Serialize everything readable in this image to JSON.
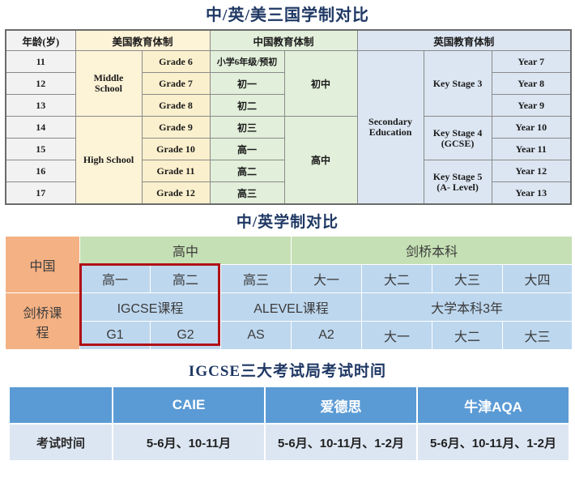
{
  "colors": {
    "title": "#1f3864",
    "us_bg": "#fdf3d7",
    "cn_bg": "#e2efda",
    "uk_bg": "#dce6f2",
    "age_bg": "#f2f2f2",
    "orange": "#f4b183",
    "green": "#c5e0b4",
    "blue_light": "#bdd7ee",
    "blue_header": "#5b9bd5",
    "highlight_border": "#b01116"
  },
  "section1": {
    "title": "中/英/美三国学制对比",
    "headers": {
      "age": "年龄(岁)",
      "us": "美国教育体制",
      "cn": "中国教育体制",
      "uk": "英国教育体制"
    },
    "rows": [
      {
        "age": "11",
        "us_school": "Middle\nSchool",
        "us_grade": "Grade 6",
        "cn_grade": "小学6年级/预初",
        "cn_stage": "初中",
        "uk_stage": "Secondary\nEducation",
        "uk_key": "Key Stage 3",
        "uk_year": "Year 7"
      },
      {
        "age": "12",
        "us_grade": "Grade 7",
        "cn_grade": "初一",
        "uk_year": "Year 8"
      },
      {
        "age": "13",
        "us_grade": "Grade 8",
        "cn_grade": "初二",
        "uk_year": "Year 9"
      },
      {
        "age": "14",
        "us_school": "High School",
        "us_grade": "Grade 9",
        "cn_grade": "初三",
        "uk_key": "Key Stage 4\n(GCSE)",
        "uk_year": "Year 10"
      },
      {
        "age": "15",
        "us_grade": "Grade 10",
        "cn_grade": "高一",
        "cn_stage": "高中",
        "uk_year": "Year 11"
      },
      {
        "age": "16",
        "us_grade": "Grade 11",
        "cn_grade": "高二",
        "uk_key": "Key Stage 5\n(A- Level)",
        "uk_year": "Year 12"
      },
      {
        "age": "17",
        "us_grade": "Grade 12",
        "cn_grade": "高三",
        "uk_year": "Year 13"
      }
    ],
    "cells": {
      "us_middle_school_line1": "Middle",
      "us_middle_school_line2": "School",
      "us_high_school": "High School",
      "cn_junior": "初中",
      "cn_senior": "高中",
      "uk_secondary_line1": "Secondary",
      "uk_secondary_line2": "Education",
      "ks3": "Key Stage 3",
      "ks4_line1": "Key Stage 4",
      "ks4_line2": "(GCSE)",
      "ks5_line1": "Key Stage 5",
      "ks5_line2": "(A- Level)"
    }
  },
  "section2": {
    "title": "中/英学制对比",
    "row_labels": {
      "china": "中国",
      "cambridge_line1": "剑桥课",
      "cambridge_line2": "程"
    },
    "stage_row": [
      {
        "label": "高中",
        "span": 3
      },
      {
        "label": "剑桥本科",
        "span": 4
      }
    ],
    "year_row": [
      "高一",
      "高二",
      "高三",
      "大一",
      "大二",
      "大三",
      "大四"
    ],
    "course_row": [
      {
        "label": "IGCSE课程",
        "span": 2
      },
      {
        "label": "ALEVEL课程",
        "span": 2
      },
      {
        "label": "大学本科3年",
        "span": 3
      }
    ],
    "level_row": [
      "G1",
      "G2",
      "AS",
      "A2",
      "大一",
      "大二",
      "大三"
    ],
    "highlight": "IGCSE阶段"
  },
  "section3": {
    "title": "IGCSE三大考试局考试时间",
    "corner_label": "",
    "boards": [
      "CAIE",
      "爱德思",
      "牛津AQA"
    ],
    "row_label": "考试时间",
    "exam_times": [
      "5-6月、10-11月",
      "5-6月、10-11月、1-2月",
      "5-6月、10-11月、1-2月"
    ]
  }
}
